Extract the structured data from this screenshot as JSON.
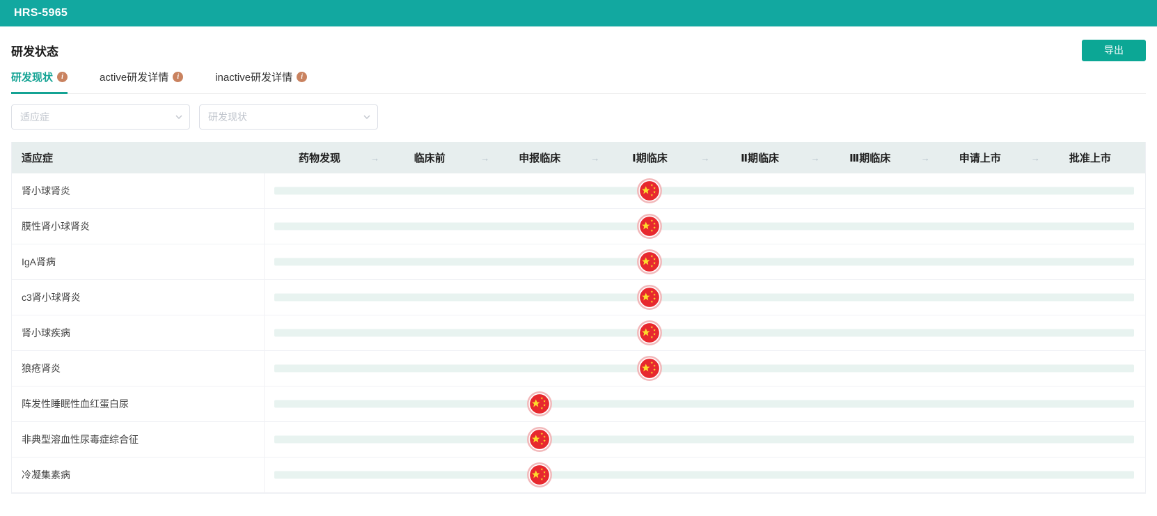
{
  "app": {
    "title": "HRS-5965"
  },
  "page": {
    "title": "研发状态",
    "export_label": "导出"
  },
  "icons": {
    "info_glyph": "i",
    "stage_arrow": "→",
    "flag_country": "china-flag"
  },
  "tabs": [
    {
      "label": "研发现状",
      "active": true
    },
    {
      "label": "active研发详情",
      "active": false
    },
    {
      "label": "inactive研发详情",
      "active": false
    }
  ],
  "filters": [
    {
      "placeholder": "适应症"
    },
    {
      "placeholder": "研发现状"
    }
  ],
  "table": {
    "indication_header": "适应症",
    "stages": [
      "药物发现",
      "临床前",
      "申报临床",
      "Ⅰ期临床",
      "Ⅱ期临床",
      "Ⅲ期临床",
      "申请上市",
      "批准上市"
    ],
    "rows": [
      {
        "indication": "肾小球肾炎",
        "stage": "Ⅰ期临床",
        "stage_index": 3,
        "marker": "china-flag"
      },
      {
        "indication": "膜性肾小球肾炎",
        "stage": "Ⅰ期临床",
        "stage_index": 3,
        "marker": "china-flag"
      },
      {
        "indication": "IgA肾病",
        "stage": "Ⅰ期临床",
        "stage_index": 3,
        "marker": "china-flag"
      },
      {
        "indication": "c3肾小球肾炎",
        "stage": "Ⅰ期临床",
        "stage_index": 3,
        "marker": "china-flag"
      },
      {
        "indication": "肾小球疾病",
        "stage": "Ⅰ期临床",
        "stage_index": 3,
        "marker": "china-flag"
      },
      {
        "indication": "狼疮肾炎",
        "stage": "Ⅰ期临床",
        "stage_index": 3,
        "marker": "china-flag"
      },
      {
        "indication": "阵发性睡眠性血红蛋白尿",
        "stage": "申报临床",
        "stage_index": 2,
        "marker": "china-flag"
      },
      {
        "indication": "非典型溶血性尿毒症综合征",
        "stage": "申报临床",
        "stage_index": 2,
        "marker": "china-flag"
      },
      {
        "indication": "冷凝集素病",
        "stage": "申报临床",
        "stage_index": 2,
        "marker": "china-flag"
      }
    ]
  },
  "colors": {
    "topbar": "#12a8a0",
    "accent_button": "#0ca795",
    "tab_active": "#14a394",
    "info_icon": "#c9825f",
    "table_header_bg": "#e7eeee",
    "bar_track": "#e8f3f0",
    "flag_red": "#e7282e",
    "flag_ring": "#f2b8ba",
    "flag_star": "#fcdc2c",
    "border": "#f0f1f5"
  }
}
